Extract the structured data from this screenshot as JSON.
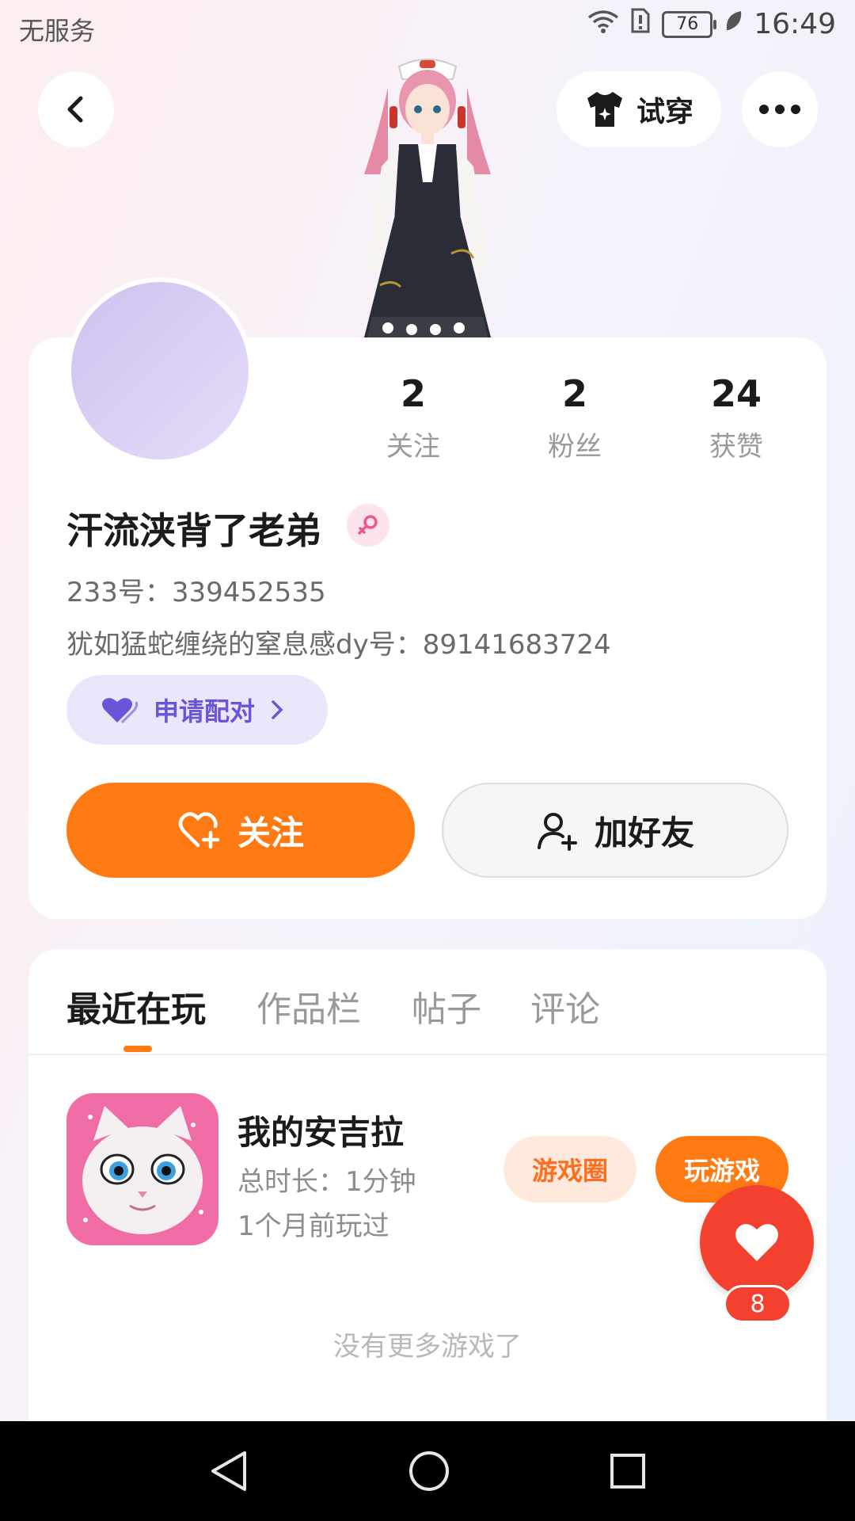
{
  "status_bar": {
    "carrier": "无服务",
    "battery": "76",
    "time": "16:49"
  },
  "header": {
    "try_on_label": "试穿"
  },
  "profile": {
    "stats": [
      {
        "value": "2",
        "label": "关注"
      },
      {
        "value": "2",
        "label": "粉丝"
      },
      {
        "value": "24",
        "label": "获赞"
      }
    ],
    "username": "汗流浃背了老弟",
    "gender": "female",
    "id_line": "233号：339452535",
    "bio": "犹如猛蛇缠绕的窒息感dy号：89141683724",
    "match_label": "申请配对",
    "follow_label": "关注",
    "add_friend_label": "加好友"
  },
  "tabs": [
    {
      "label": "最近在玩",
      "active": true
    },
    {
      "label": "作品栏",
      "active": false
    },
    {
      "label": "帖子",
      "active": false
    },
    {
      "label": "评论",
      "active": false
    }
  ],
  "game": {
    "title": "我的安吉拉",
    "duration": "总时长：1分钟",
    "last_played": "1个月前玩过",
    "circle_label": "游戏圈",
    "play_label": "玩游戏"
  },
  "list_end_text": "没有更多游戏了",
  "like": {
    "count": "8"
  },
  "colors": {
    "accent": "#ff7a12",
    "like_red": "#f4402f",
    "match_purple": "#6a55d8"
  }
}
